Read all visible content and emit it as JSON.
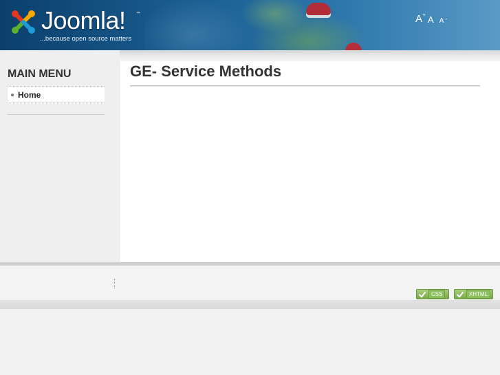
{
  "header": {
    "logo_text": "Joomla!",
    "logo_tm": "™",
    "tagline": "...because open source matters",
    "font_size_tools": {
      "increase_label": "A",
      "increase_sup": "+",
      "reset_label": "A",
      "decrease_label": "A",
      "decrease_sup": "-"
    }
  },
  "sidebar": {
    "menu_title": "MAIN MENU",
    "items": [
      {
        "label": "Home"
      }
    ]
  },
  "main": {
    "page_title": "GE- Service Methods"
  },
  "footer": {
    "badges": [
      {
        "label": "CSS",
        "icon": "check-icon"
      },
      {
        "label": "XHTML",
        "icon": "check-icon"
      }
    ]
  },
  "colors": {
    "header_blue": "#1b5f92",
    "sidebar_bg": "#efefef",
    "badge_green": "#79a94a",
    "title_text": "#333333"
  }
}
